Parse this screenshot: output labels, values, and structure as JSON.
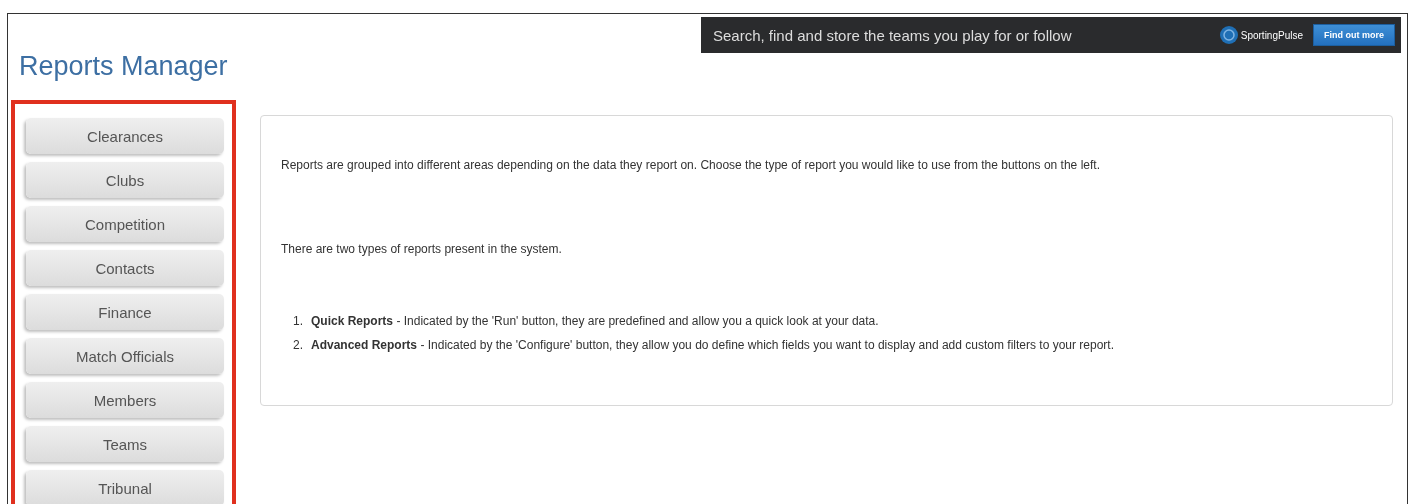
{
  "title": "Reports Manager",
  "banner": {
    "text": "Search, find and store the teams you play for or follow",
    "brand": "SportingPulse",
    "button": "Find out more"
  },
  "sidebar": {
    "highlighted": true,
    "items": [
      {
        "label": "Clearances"
      },
      {
        "label": "Clubs"
      },
      {
        "label": "Competition"
      },
      {
        "label": "Contacts"
      },
      {
        "label": "Finance"
      },
      {
        "label": "Match Officials"
      },
      {
        "label": "Members"
      },
      {
        "label": "Teams"
      },
      {
        "label": "Tribunal"
      }
    ]
  },
  "content": {
    "paragraphs": [
      "Reports are grouped into different areas depending on the data they report on. Choose the type of report you would like to use from the buttons on the left.",
      "There are two types of reports present in the system."
    ],
    "list": [
      {
        "number": "1.",
        "text": "**Quick Reports** - Indicated by the 'Run' button, they are predefined and allow you a quick look at your data."
      },
      {
        "number": "2.",
        "text": "**Advanced Reports** - Indicated by the 'Configure' button, they allow you do define which fields you want to display and add custom filters to your report."
      }
    ]
  }
}
